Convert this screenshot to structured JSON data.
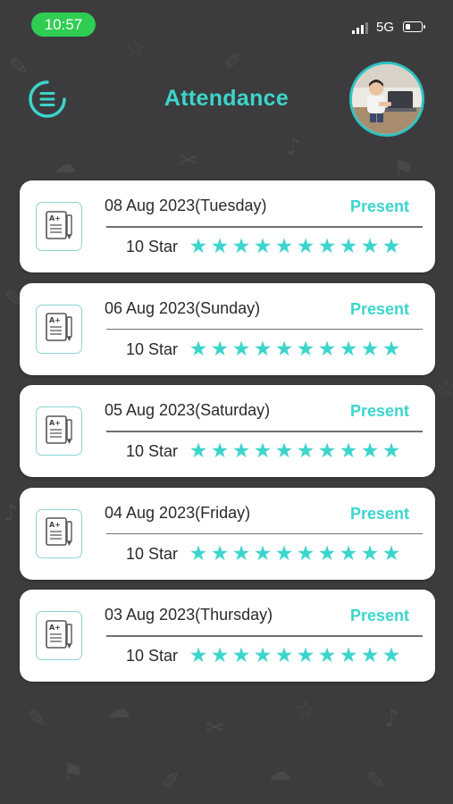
{
  "status_bar": {
    "time": "10:57",
    "network": "5G"
  },
  "header": {
    "title": "Attendance",
    "menu_icon": "menu-icon",
    "avatar_icon": "profile-avatar"
  },
  "colors": {
    "accent": "#3cd5cc",
    "background": "#3c3c3e",
    "card": "#ffffff",
    "time_pill": "#2fcd52"
  },
  "records": [
    {
      "date": "08 Aug 2023(Tuesday)",
      "status": "Present",
      "stars_label": "10 Star",
      "star_count": 10,
      "icon": "report-card-icon"
    },
    {
      "date": "06 Aug 2023(Sunday)",
      "status": "Present",
      "stars_label": "10 Star",
      "star_count": 10,
      "icon": "report-card-icon"
    },
    {
      "date": "05 Aug 2023(Saturday)",
      "status": "Present",
      "stars_label": "10 Star",
      "star_count": 10,
      "icon": "report-card-icon"
    },
    {
      "date": "04 Aug 2023(Friday)",
      "status": "Present",
      "stars_label": "10 Star",
      "star_count": 10,
      "icon": "report-card-icon"
    },
    {
      "date": "03 Aug 2023(Thursday)",
      "status": "Present",
      "stars_label": "10 Star",
      "star_count": 10,
      "icon": "report-card-icon"
    }
  ]
}
